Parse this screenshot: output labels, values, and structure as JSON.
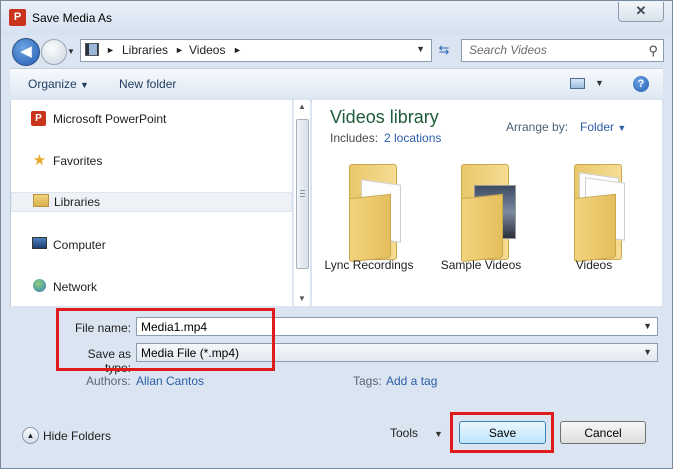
{
  "window": {
    "title": "Save Media As",
    "app_icon": "powerpoint-icon",
    "close_glyph": "✕"
  },
  "address_bar": {
    "segments": [
      "Libraries",
      "Videos"
    ],
    "separator": "►",
    "icon": "library-videos-icon"
  },
  "search": {
    "placeholder": "Search Videos"
  },
  "toolbar": {
    "organize_label": "Organize",
    "new_folder_label": "New folder"
  },
  "nav": {
    "items": [
      {
        "label": "Microsoft PowerPoint",
        "icon": "powerpoint-icon"
      },
      {
        "label": "Favorites",
        "icon": "star-icon"
      },
      {
        "label": "Libraries",
        "icon": "libraries-icon",
        "selected": true
      },
      {
        "label": "Computer",
        "icon": "computer-icon"
      },
      {
        "label": "Network",
        "icon": "network-icon"
      }
    ]
  },
  "library": {
    "title": "Videos library",
    "includes_label": "Includes:",
    "includes_link": "2 locations",
    "arrange_label": "Arrange by:",
    "arrange_value": "Folder",
    "folders": [
      {
        "name": "Lync Recordings",
        "icon": "folder-icon"
      },
      {
        "name": "Sample Videos",
        "icon": "folder-icon"
      },
      {
        "name": "Videos",
        "icon": "folder-icon"
      }
    ]
  },
  "form": {
    "file_name_label": "File name:",
    "file_name_value": "Media1.mp4",
    "save_type_label": "Save as type:",
    "save_type_value": "Media File (*.mp4)",
    "authors_label": "Authors:",
    "authors_value": "Allan Cantos",
    "tags_label": "Tags:",
    "tags_value": "Add a tag"
  },
  "footer": {
    "hide_folders_label": "Hide Folders",
    "tools_label": "Tools",
    "save_label": "Save",
    "cancel_label": "Cancel"
  },
  "colors": {
    "highlight": "#e01b1b",
    "link": "#2c5ea8",
    "library_title": "#1e5b3a"
  }
}
